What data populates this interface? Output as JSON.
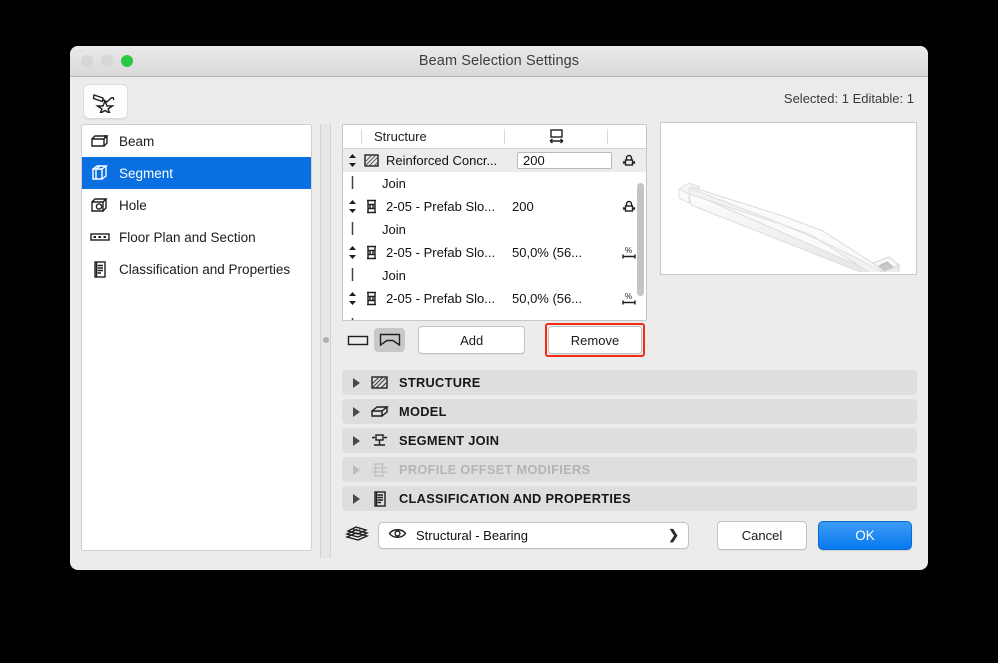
{
  "window": {
    "title": "Beam Selection Settings",
    "selection_status": "Selected: 1 Editable: 1",
    "tool_icon": "arrow-star-selection-icon",
    "traffic_lights": [
      "close",
      "minimize",
      "zoom"
    ]
  },
  "sidebar": {
    "items": [
      {
        "label": "Beam",
        "icon": "beam-icon",
        "selected": false
      },
      {
        "label": "Segment",
        "icon": "segment-cube-icon",
        "selected": true
      },
      {
        "label": "Hole",
        "icon": "hole-icon",
        "selected": false
      },
      {
        "label": "Floor Plan and Section",
        "icon": "floor-plan-icon",
        "selected": false
      },
      {
        "label": "Classification and Properties",
        "icon": "document-list-icon",
        "selected": false
      }
    ]
  },
  "structure_list": {
    "headers": {
      "name": "Structure",
      "width_icon": "width-dimension-icon"
    },
    "rows": [
      {
        "type": "segment",
        "icon": "hatched-concrete-icon",
        "name": "Reinforced Concr...",
        "value": "200",
        "value_boxed": true,
        "lock": "lock-icon",
        "highlighted": true
      },
      {
        "type": "join",
        "name": "Join"
      },
      {
        "type": "segment",
        "icon": "i-beam-icon",
        "name": "2-05 - Prefab Slo...",
        "value": "200",
        "value_boxed": false,
        "lock": "lock-icon",
        "highlighted": false
      },
      {
        "type": "join",
        "name": "Join"
      },
      {
        "type": "segment",
        "icon": "i-beam-icon",
        "name": "2-05 - Prefab Slo...",
        "value": "50,0% (56...",
        "value_boxed": false,
        "lock": "percent-dimension-icon",
        "highlighted": false
      },
      {
        "type": "join",
        "name": "Join"
      },
      {
        "type": "segment",
        "icon": "i-beam-icon",
        "name": "2-05 - Prefab Slo...",
        "value": "50,0% (56...",
        "value_boxed": false,
        "lock": "percent-dimension-icon",
        "highlighted": false
      }
    ]
  },
  "segment_controls": {
    "straight_toggle": {
      "icon": "straight-segment-icon",
      "active": false
    },
    "tapered_toggle": {
      "icon": "tapered-segment-icon",
      "active": true
    },
    "add_label": "Add",
    "remove_label": "Remove",
    "remove_highlight_color": "#f52b16"
  },
  "preview": {
    "name": "beam-3d-preview",
    "description": "3D preview of sloped prefabricated beam"
  },
  "accordion": [
    {
      "label": "STRUCTURE",
      "icon": "hatched-structure-icon",
      "disabled": false
    },
    {
      "label": "MODEL",
      "icon": "model-box-icon",
      "disabled": false
    },
    {
      "label": "SEGMENT JOIN",
      "icon": "segment-join-icon",
      "disabled": false
    },
    {
      "label": "PROFILE OFFSET MODIFIERS",
      "icon": "profile-offset-icon",
      "disabled": true
    },
    {
      "label": "CLASSIFICATION AND PROPERTIES",
      "icon": "document-list-icon",
      "disabled": false
    }
  ],
  "footer": {
    "layers_icon": "layers-stack-icon",
    "layer_visibility_icon": "eye-icon",
    "layer_value": "Structural - Bearing",
    "layer_chevron": "❯",
    "cancel_label": "Cancel",
    "ok_label": "OK",
    "ok_color": "#067af0"
  }
}
